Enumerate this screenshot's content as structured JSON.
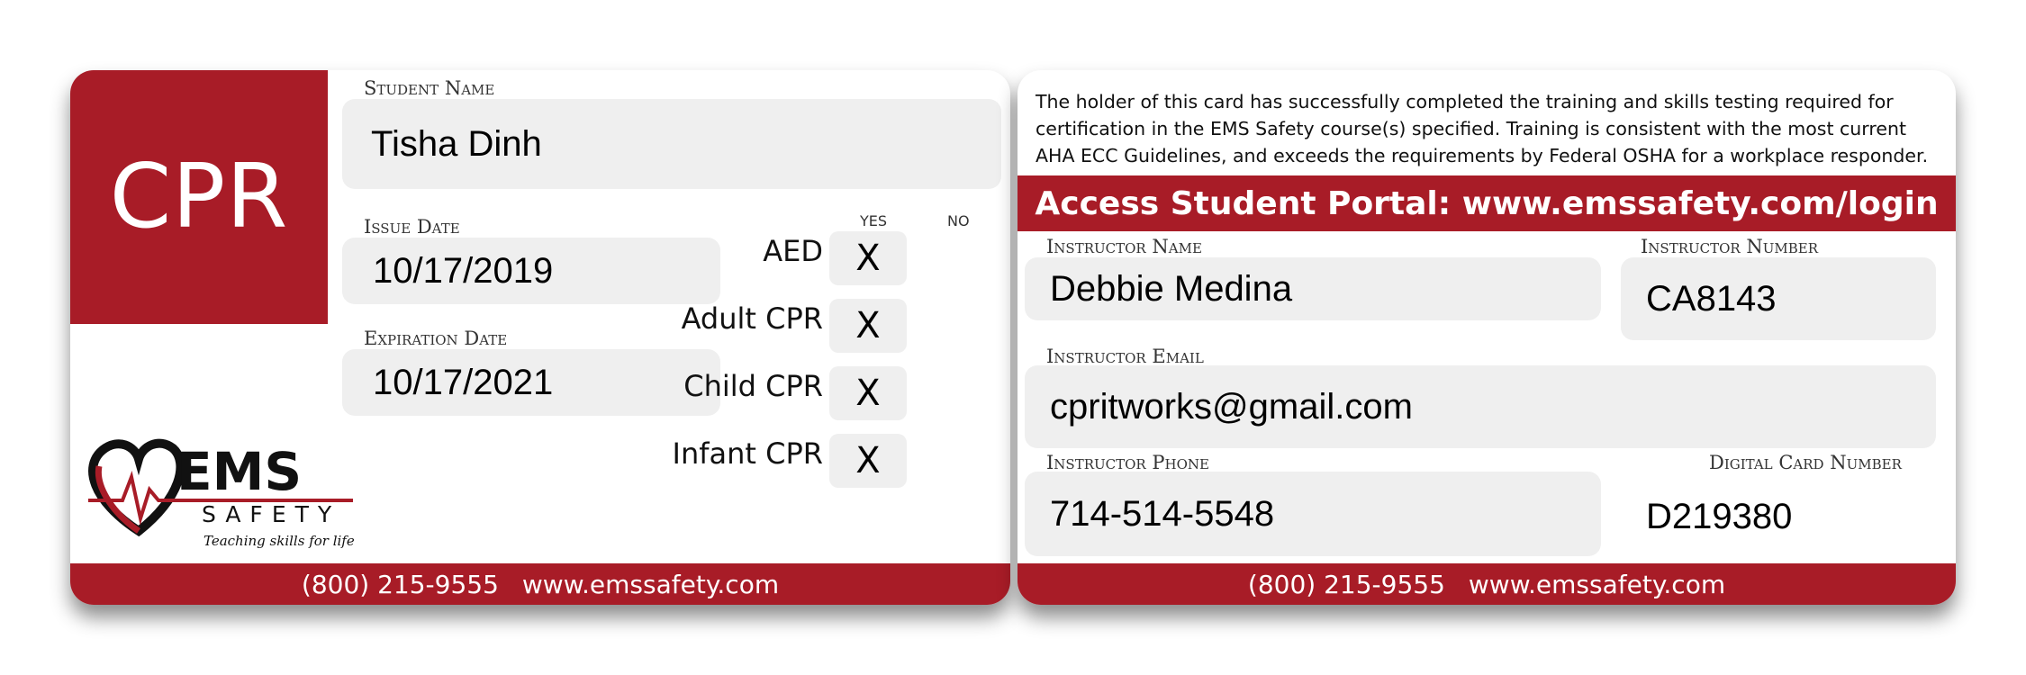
{
  "brand": {
    "accent_color": "#a81c27",
    "logo_text": "EMS",
    "logo_subtext": "SAFETY",
    "tagline": "Teaching skills for life"
  },
  "front": {
    "course_code": "CPR",
    "student_name_label": "Student Name",
    "student_name": "Tisha Dinh",
    "issue_date_label": "Issue Date",
    "issue_date": "10/17/2019",
    "expiration_date_label": "Expiration Date",
    "expiration_date": "10/17/2021",
    "yes_label": "YES",
    "no_label": "NO",
    "courses": [
      {
        "name": "AED",
        "yes": "X"
      },
      {
        "name": "Adult CPR",
        "yes": "X"
      },
      {
        "name": "Child CPR",
        "yes": "X"
      },
      {
        "name": "Infant CPR",
        "yes": "X"
      }
    ],
    "phone": "(800) 215-9555",
    "website": "www.emssafety.com"
  },
  "back": {
    "statement": "The holder of this card has successfully completed the training and skills testing required for certification in the EMS Safety course(s) specified. Training is consistent with the most current AHA ECC Guidelines, and exceeds the requirements by Federal OSHA for a workplace responder.",
    "portal_text": "Access Student Portal: www.emssafety.com/login",
    "instructor_name_label": "Instructor Name",
    "instructor_name": "Debbie Medina",
    "instructor_number_label": "Instructor Number",
    "instructor_number": "CA8143",
    "instructor_email_label": "Instructor Email",
    "instructor_email": "cpritworks@gmail.com",
    "instructor_phone_label": "Instructor Phone",
    "instructor_phone": "714-514-5548",
    "digital_card_number_label": "Digital Card Number",
    "digital_card_number": "D219380",
    "phone": "(800) 215-9555",
    "website": "www.emssafety.com"
  }
}
